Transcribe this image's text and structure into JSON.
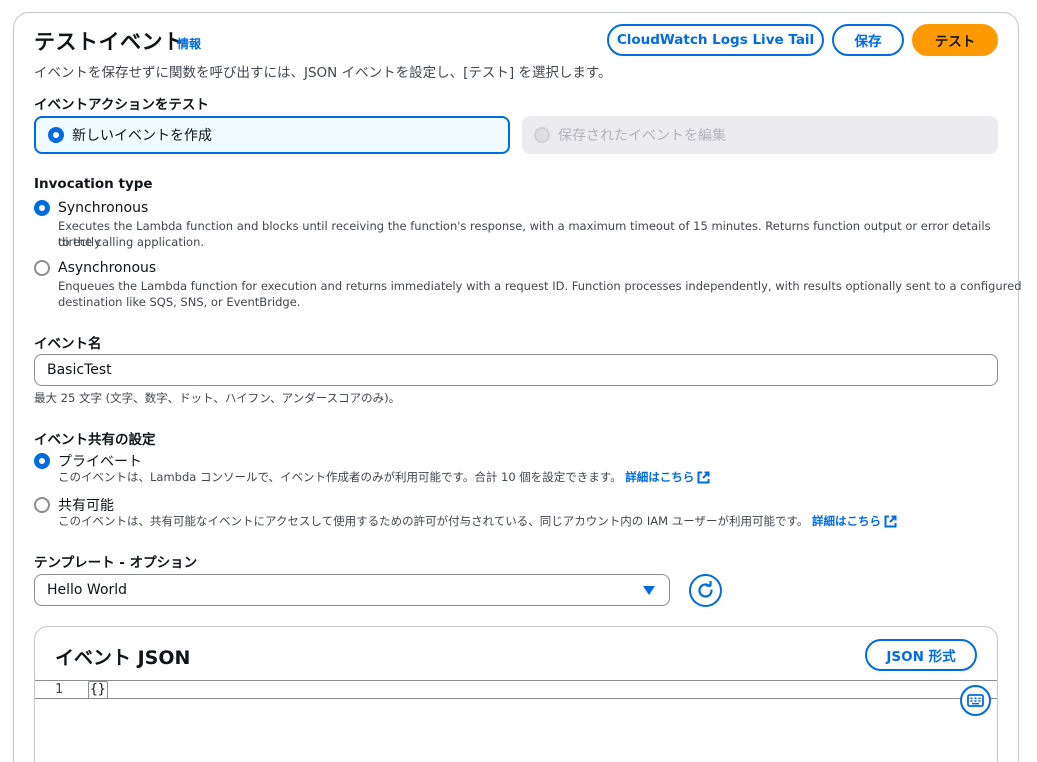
{
  "header": {
    "title": "テストイベント",
    "info_link": "情報",
    "subtitle": "イベントを保存せずに関数を呼び出すには、JSON イベントを設定し、[テスト] を選択します。",
    "buttons": {
      "live_tail": "CloudWatch Logs Live Tail",
      "save": "保存",
      "test": "テスト"
    }
  },
  "event_action": {
    "label": "イベントアクションをテスト",
    "options": [
      {
        "label": "新しいイベントを作成",
        "selected": true,
        "disabled": false
      },
      {
        "label": "保存されたイベントを編集",
        "selected": false,
        "disabled": true
      }
    ]
  },
  "invocation": {
    "label": "Invocation type",
    "options": [
      {
        "label": "Synchronous",
        "selected": true,
        "desc_line1": "Executes the Lambda function and blocks until receiving the function's response, with a maximum timeout of 15 minutes. Returns function output or error details directly",
        "desc_line2": "to the calling application."
      },
      {
        "label": "Asynchronous",
        "selected": false,
        "desc_line1": "Enqueues the Lambda function for execution and returns immediately with a request ID. Function processes independently, with results optionally sent to a configured",
        "desc_line2": "destination like SQS, SNS, or EventBridge."
      }
    ]
  },
  "event_name": {
    "label": "イベント名",
    "value": "BasicTest",
    "help": "最大 25 文字 (文字、数字、ドット、ハイフン、アンダースコアのみ)。"
  },
  "sharing": {
    "label": "イベント共有の設定",
    "options": [
      {
        "label": "プライベート",
        "selected": true,
        "desc": "このイベントは、Lambda コンソールで、イベント作成者のみが利用可能です。合計 10 個を設定できます。",
        "link": "詳細はこちら"
      },
      {
        "label": "共有可能",
        "selected": false,
        "desc": "このイベントは、共有可能なイベントにアクセスして使用するための許可が付与されている、同じアカウント内の IAM ユーザーが利用可能です。",
        "link": "詳細はこちら"
      }
    ]
  },
  "template": {
    "label": "テンプレート - オプション",
    "selected": "Hello World"
  },
  "event_json": {
    "title": "イベント JSON",
    "format_button": "JSON 形式",
    "lines": [
      {
        "num": "1",
        "code": "{}"
      }
    ]
  },
  "colors": {
    "accent": "#006ce0",
    "primary_button": "#ff9900",
    "border": "#8c8c94"
  }
}
